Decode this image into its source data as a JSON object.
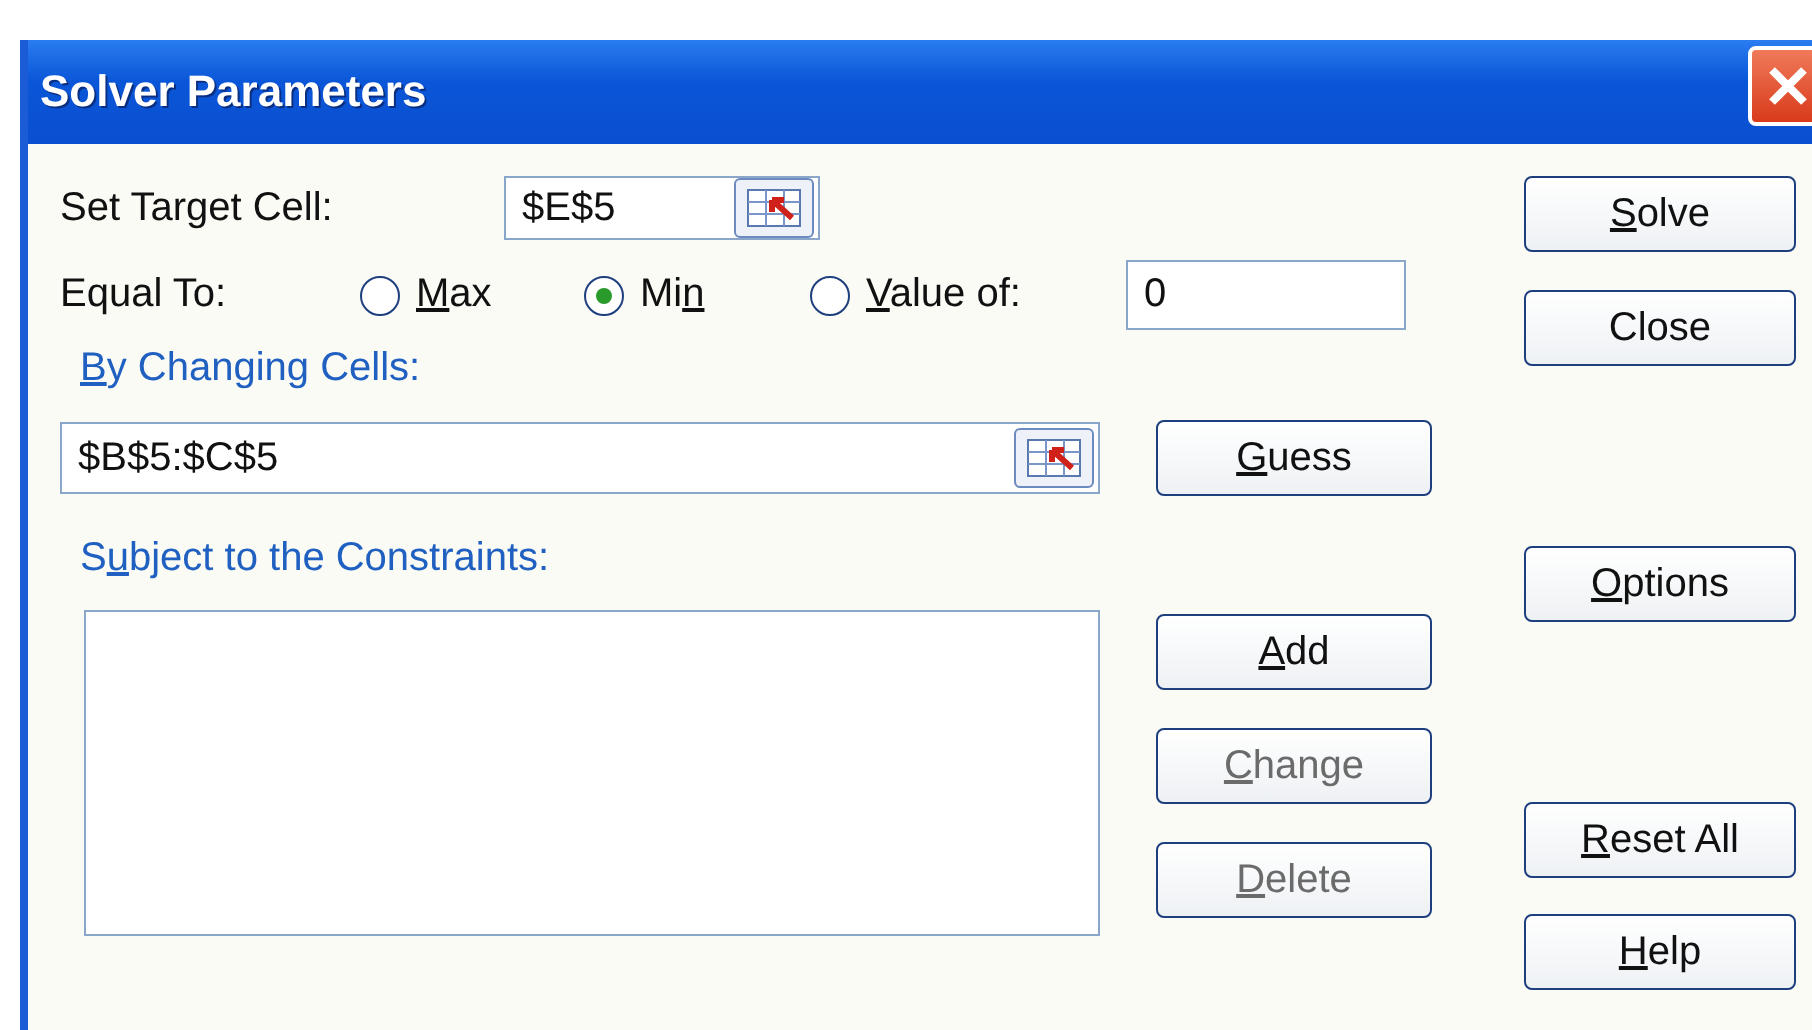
{
  "window": {
    "title": "Solver Parameters"
  },
  "target_cell": {
    "label": "Set Target Cell:",
    "value": "$E$5"
  },
  "equal_to": {
    "label": "Equal To:",
    "options": [
      {
        "key": "M",
        "post": "ax",
        "selected": false
      },
      {
        "pre": "Mi",
        "key": "n",
        "selected": true
      },
      {
        "key": "V",
        "post": "alue of:",
        "selected": false
      }
    ],
    "value": "0"
  },
  "changing_cells": {
    "label": {
      "key": "B",
      "post": "y Changing Cells:"
    },
    "value": "$B$5:$C$5",
    "guess_button": {
      "key": "G",
      "post": "uess",
      "disabled": false
    }
  },
  "constraints": {
    "label": {
      "pre": "S",
      "key": "u",
      "post": "bject to the Constraints:"
    },
    "buttons": [
      {
        "key": "A",
        "post": "dd",
        "disabled": false
      },
      {
        "key": "C",
        "post": "hange",
        "disabled": true
      },
      {
        "key": "D",
        "post": "elete",
        "disabled": true
      }
    ]
  },
  "side_buttons": [
    {
      "key": "S",
      "post": "olve",
      "disabled": false
    },
    {
      "pre": "Close",
      "disabled": false
    },
    {
      "key": "O",
      "post": "ptions",
      "disabled": false
    },
    {
      "key": "R",
      "post": "eset All",
      "disabled": false
    },
    {
      "key": "H",
      "post": "elp",
      "disabled": false
    }
  ]
}
